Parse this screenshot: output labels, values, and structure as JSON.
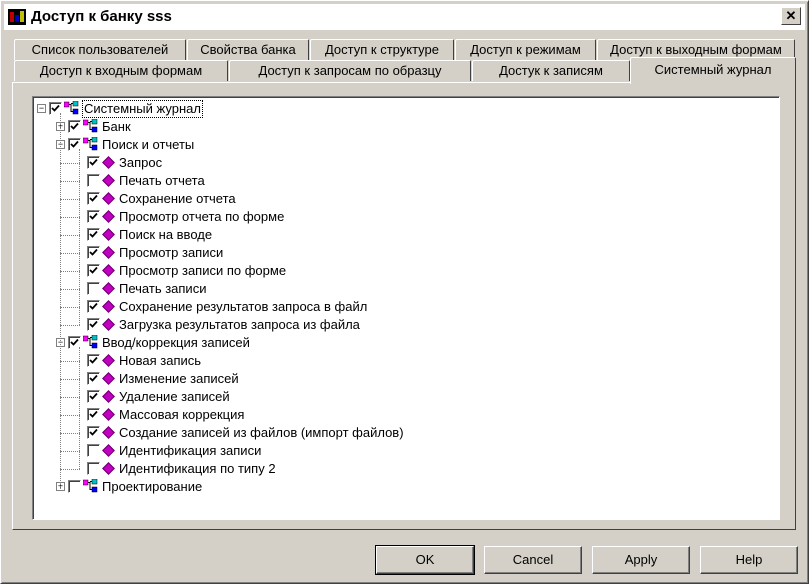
{
  "window": {
    "title": "Доступ к банку sss",
    "close_glyph": "✕"
  },
  "tabs_row1": [
    {
      "label": "Список пользователей"
    },
    {
      "label": "Свойства банка"
    },
    {
      "label": "Доступ к структуре"
    },
    {
      "label": "Доступ к режимам"
    },
    {
      "label": "Доступ к выходным формам"
    }
  ],
  "tabs_row2": [
    {
      "label": "Доступ к входным формам"
    },
    {
      "label": "Доступ к запросам по образцу"
    },
    {
      "label": "Достук к записям"
    },
    {
      "label": "Системный журнал",
      "active": true
    }
  ],
  "tree": {
    "root": {
      "label": "Системный журнал",
      "checked": true,
      "expanded": true
    },
    "groups": [
      {
        "label": "Банк",
        "checked": true,
        "expanded": false,
        "items": []
      },
      {
        "label": "Поиск и отчеты",
        "checked": true,
        "expanded": true,
        "items": [
          {
            "label": "Запрос",
            "checked": true
          },
          {
            "label": "Печать отчета",
            "checked": false
          },
          {
            "label": "Сохранение отчета",
            "checked": true
          },
          {
            "label": "Просмотр отчета по форме",
            "checked": true
          },
          {
            "label": "Поиск на вводе",
            "checked": true
          },
          {
            "label": "Просмотр записи",
            "checked": true
          },
          {
            "label": "Просмотр записи по форме",
            "checked": true
          },
          {
            "label": "Печать записи",
            "checked": false
          },
          {
            "label": "Сохранение результатов запроса в файл",
            "checked": true
          },
          {
            "label": "Загрузка  результатов запроса из файла",
            "checked": true
          }
        ]
      },
      {
        "label": "Ввод/коррекция записей",
        "checked": true,
        "expanded": true,
        "items": [
          {
            "label": "Новая запись",
            "checked": true
          },
          {
            "label": "Изменение записей",
            "checked": true
          },
          {
            "label": "Удаление записей",
            "checked": true
          },
          {
            "label": "Массовая коррекция",
            "checked": true
          },
          {
            "label": "Создание записей из файлов (импорт файлов)",
            "checked": true
          },
          {
            "label": "Идентификация записи",
            "checked": false
          },
          {
            "label": "Идентификация по типу 2",
            "checked": false
          }
        ]
      },
      {
        "label": "Проектирование",
        "checked": false,
        "expanded": false,
        "items": []
      }
    ]
  },
  "buttons": {
    "ok": "OK",
    "cancel": "Cancel",
    "apply": "Apply",
    "help": "Help"
  },
  "colors": {
    "face": "#d4d0c8",
    "selection": "#000080",
    "item_icon": "#c000c0"
  }
}
